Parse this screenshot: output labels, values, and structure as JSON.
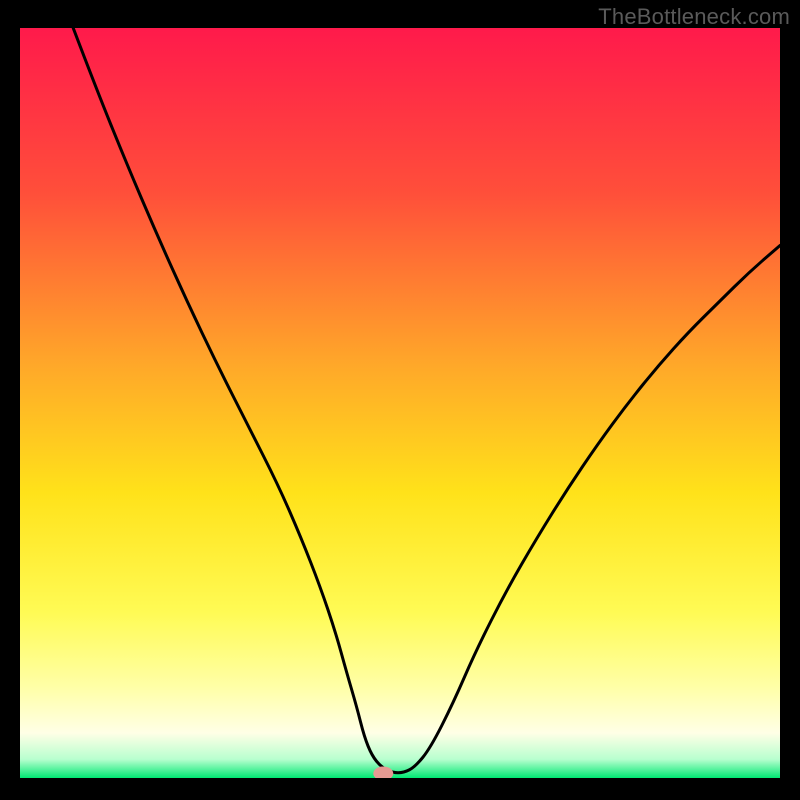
{
  "watermark": "TheBottleneck.com",
  "chart_data": {
    "type": "line",
    "title": "",
    "xlabel": "",
    "ylabel": "",
    "xlim": [
      0,
      100
    ],
    "ylim": [
      0,
      100
    ],
    "grid": false,
    "background_gradient": {
      "stops": [
        {
          "offset": 0.0,
          "color": "#ff1a4b"
        },
        {
          "offset": 0.22,
          "color": "#ff4f3a"
        },
        {
          "offset": 0.45,
          "color": "#ffa829"
        },
        {
          "offset": 0.62,
          "color": "#ffe21a"
        },
        {
          "offset": 0.78,
          "color": "#fffb55"
        },
        {
          "offset": 0.88,
          "color": "#ffffa8"
        },
        {
          "offset": 0.94,
          "color": "#ffffe6"
        },
        {
          "offset": 0.975,
          "color": "#b8ffcf"
        },
        {
          "offset": 1.0,
          "color": "#00e873"
        }
      ]
    },
    "series": [
      {
        "name": "bottleneck-curve",
        "color": "#000000",
        "x": [
          7,
          10,
          14,
          18,
          22,
          26,
          30,
          34,
          37,
          39.5,
          41.5,
          43,
          44.3,
          45.3,
          46.3,
          47.5,
          49,
          50.5,
          52,
          54,
          57,
          60,
          64,
          68,
          72,
          76,
          80,
          84,
          88,
          92,
          96,
          100
        ],
        "y": [
          100,
          92,
          82,
          72.5,
          63.5,
          55,
          47,
          39,
          32,
          25.5,
          19.5,
          14,
          9.5,
          5.5,
          3,
          1.5,
          0.7,
          0.7,
          1.5,
          4,
          10,
          17,
          25,
          32,
          38.5,
          44.5,
          50,
          55,
          59.5,
          63.5,
          67.5,
          71
        ]
      }
    ],
    "marker": {
      "name": "optimal-point",
      "x": 47.8,
      "y": 0.6,
      "color": "#e59a93",
      "rx": 10,
      "ry": 7
    }
  }
}
